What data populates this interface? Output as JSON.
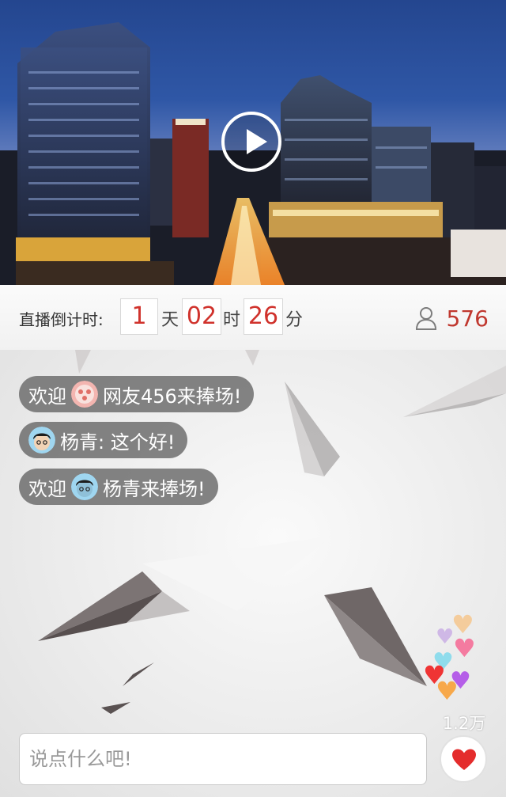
{
  "countdown": {
    "label": "直播倒计时:",
    "days": "1",
    "days_unit": "天",
    "hours": "02",
    "hours_unit": "时",
    "minutes": "26",
    "minutes_unit": "分"
  },
  "viewers": {
    "icon": "person-icon",
    "count": "576"
  },
  "messages": [
    {
      "prefix": "欢迎",
      "text": "网友456来捧场!"
    },
    {
      "prefix": "",
      "text": "杨青: 这个好!"
    },
    {
      "prefix": "欢迎",
      "text": "杨青来捧场!"
    }
  ],
  "likes": {
    "count": "1.2万"
  },
  "input": {
    "placeholder": "说点什么吧!"
  },
  "colors": {
    "accent": "#d0322c",
    "bubble": "#6e6e6e"
  }
}
